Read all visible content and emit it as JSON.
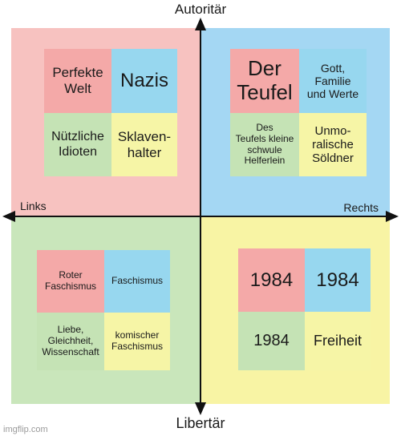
{
  "axes": {
    "top": "Autoritär",
    "bottom": "Libertär",
    "left": "Links",
    "right": "Rechts"
  },
  "quadrants": {
    "top_left": {
      "cells": [
        "Perfekte\nWelt",
        "Nazis",
        "Nützliche\nIdioten",
        "Sklaven-\nhalter"
      ]
    },
    "top_right": {
      "cells": [
        "Der\nTeufel",
        "Gott,\nFamilie\nund Werte",
        "Des\nTeufels kleine\nschwule\nHelferlein",
        "Unmo-\nralische\nSöldner"
      ]
    },
    "bottom_left": {
      "cells": [
        "Roter\nFaschismus",
        "Faschismus",
        "Liebe,\nGleichheit,\nWissenschaft",
        "komischer\nFaschismus"
      ]
    },
    "bottom_right": {
      "cells": [
        "1984",
        "1984",
        "1984",
        "Freiheit"
      ]
    }
  },
  "watermark": "imgflip.com",
  "colors": {
    "pink": "#f4a9a8",
    "blue": "#97d7ef",
    "green": "#c5e3b5",
    "yellow": "#f6f5a6",
    "axis": "#111111"
  }
}
